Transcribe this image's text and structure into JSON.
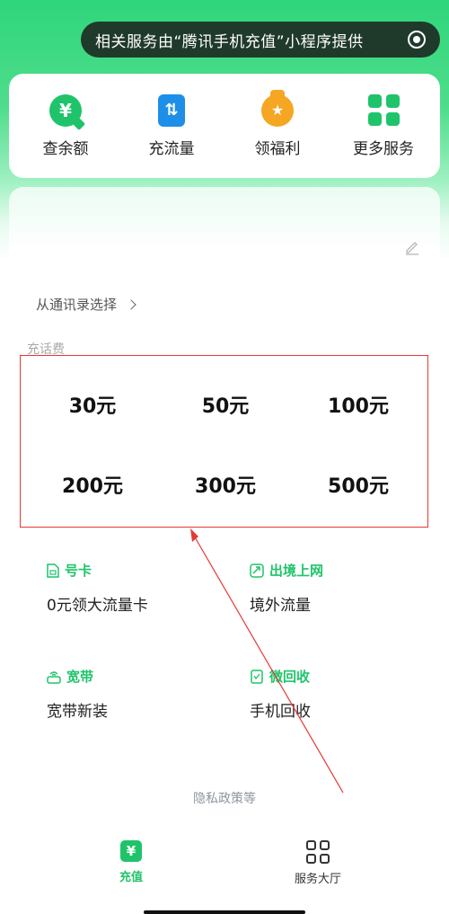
{
  "miniprogram_bar": {
    "text": "相关服务由“腾讯手机充值”小程序提供",
    "target_icon": "record-target-icon"
  },
  "quick_actions": [
    {
      "label": "查余额",
      "icon": "yen-bubble-icon",
      "icon_glyph": "¥"
    },
    {
      "label": "充流量",
      "icon": "data-arrows-icon",
      "icon_glyph": "⇅"
    },
    {
      "label": "领福利",
      "icon": "gift-bag-icon",
      "icon_glyph": "★"
    },
    {
      "label": "更多服务",
      "icon": "grid-apps-icon",
      "icon_glyph": ""
    }
  ],
  "phone_input": {
    "value": "",
    "edit_icon": "pencil-icon"
  },
  "contacts": {
    "label": "从通讯录选择"
  },
  "recharge": {
    "section_label": "充话费",
    "amounts": [
      "30元",
      "50元",
      "100元",
      "200元",
      "300元",
      "500元"
    ]
  },
  "services": [
    {
      "tag": "号卡",
      "title": "0元领大流量卡",
      "icon": "sim-card-icon"
    },
    {
      "tag": "出境上网",
      "title": "境外流量",
      "icon": "airplane-icon"
    },
    {
      "tag": "宽带",
      "title": "宽带新装",
      "icon": "wifi-router-icon"
    },
    {
      "tag": "微回收",
      "title": "手机回收",
      "icon": "recycle-phone-icon"
    }
  ],
  "footer": {
    "privacy": "隐私政策等"
  },
  "tabbar": {
    "recharge_label": "充值",
    "recharge_glyph": "¥",
    "hall_label": "服务大厅"
  },
  "colors": {
    "brand_green": "#1fc46a",
    "highlight_red": "#e53935",
    "data_blue": "#1e8fe8",
    "welfare_orange": "#f5a623"
  }
}
